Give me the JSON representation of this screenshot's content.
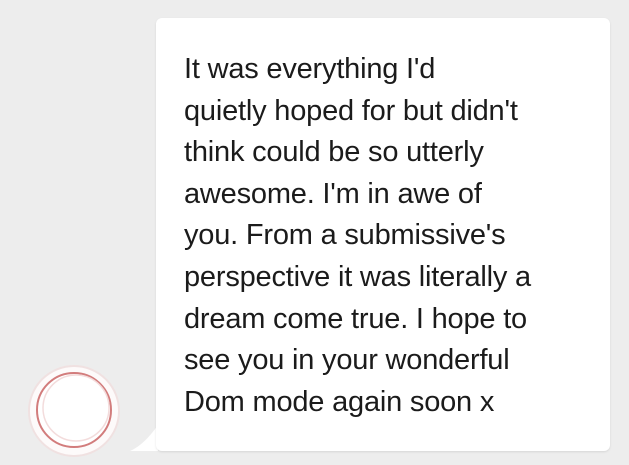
{
  "conversation": {
    "received_message": {
      "text": "It was everything I'd\nquietly hoped for but didn't\nthink could be so utterly\nawesome. I'm in awe of\nyou. From a submissive's\nperspective it was literally a\ndream come true. I hope to\nsee you in your wonderful\nDom mode again soon x",
      "bubble_color": "#ffffff",
      "text_color": "#1b1b1b"
    },
    "sender_avatar": {
      "icon": "avatar-placeholder-icon"
    },
    "background_color": "#ededed"
  }
}
